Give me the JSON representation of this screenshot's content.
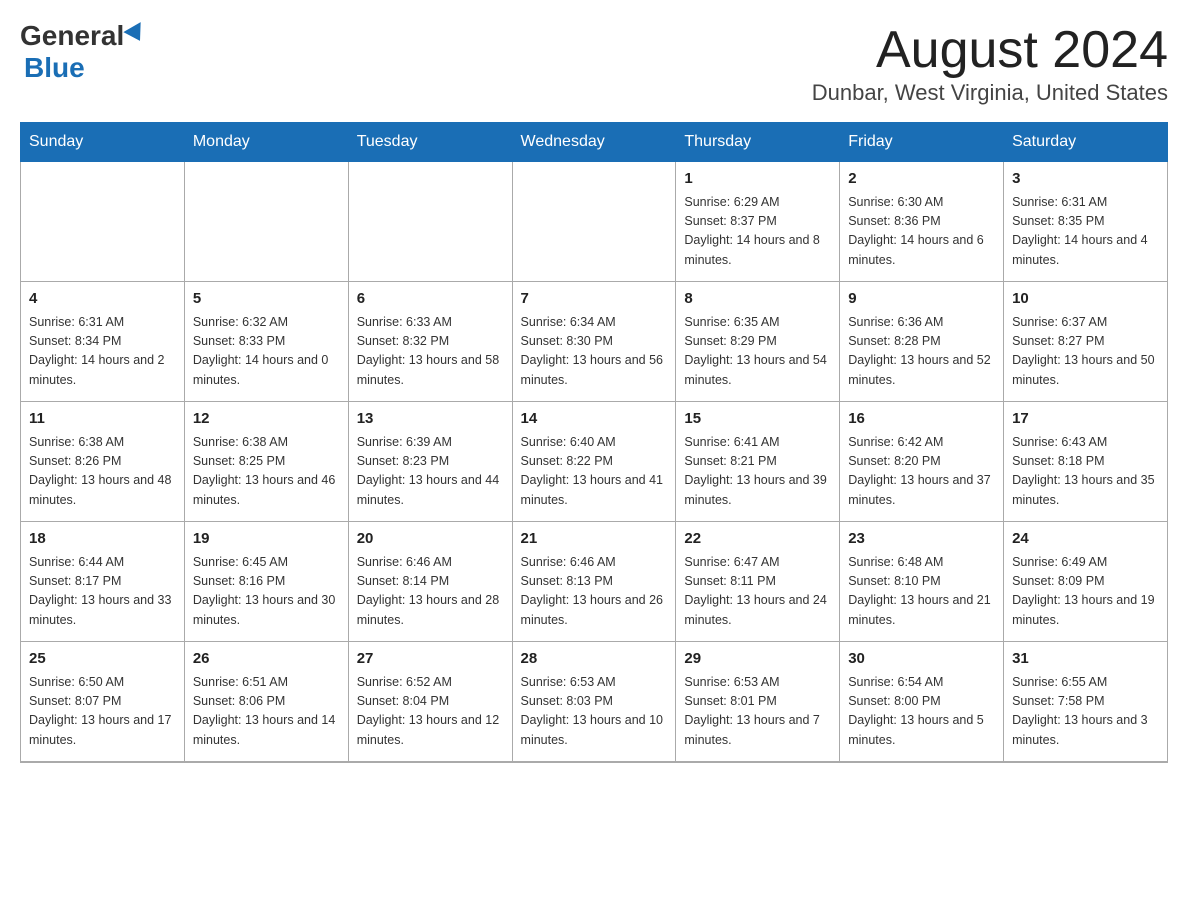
{
  "header": {
    "logo_general": "General",
    "logo_blue": "Blue",
    "title": "August 2024",
    "subtitle": "Dunbar, West Virginia, United States"
  },
  "days_of_week": [
    "Sunday",
    "Monday",
    "Tuesday",
    "Wednesday",
    "Thursday",
    "Friday",
    "Saturday"
  ],
  "weeks": [
    [
      {
        "day": "",
        "info": ""
      },
      {
        "day": "",
        "info": ""
      },
      {
        "day": "",
        "info": ""
      },
      {
        "day": "",
        "info": ""
      },
      {
        "day": "1",
        "info": "Sunrise: 6:29 AM\nSunset: 8:37 PM\nDaylight: 14 hours and 8 minutes."
      },
      {
        "day": "2",
        "info": "Sunrise: 6:30 AM\nSunset: 8:36 PM\nDaylight: 14 hours and 6 minutes."
      },
      {
        "day": "3",
        "info": "Sunrise: 6:31 AM\nSunset: 8:35 PM\nDaylight: 14 hours and 4 minutes."
      }
    ],
    [
      {
        "day": "4",
        "info": "Sunrise: 6:31 AM\nSunset: 8:34 PM\nDaylight: 14 hours and 2 minutes."
      },
      {
        "day": "5",
        "info": "Sunrise: 6:32 AM\nSunset: 8:33 PM\nDaylight: 14 hours and 0 minutes."
      },
      {
        "day": "6",
        "info": "Sunrise: 6:33 AM\nSunset: 8:32 PM\nDaylight: 13 hours and 58 minutes."
      },
      {
        "day": "7",
        "info": "Sunrise: 6:34 AM\nSunset: 8:30 PM\nDaylight: 13 hours and 56 minutes."
      },
      {
        "day": "8",
        "info": "Sunrise: 6:35 AM\nSunset: 8:29 PM\nDaylight: 13 hours and 54 minutes."
      },
      {
        "day": "9",
        "info": "Sunrise: 6:36 AM\nSunset: 8:28 PM\nDaylight: 13 hours and 52 minutes."
      },
      {
        "day": "10",
        "info": "Sunrise: 6:37 AM\nSunset: 8:27 PM\nDaylight: 13 hours and 50 minutes."
      }
    ],
    [
      {
        "day": "11",
        "info": "Sunrise: 6:38 AM\nSunset: 8:26 PM\nDaylight: 13 hours and 48 minutes."
      },
      {
        "day": "12",
        "info": "Sunrise: 6:38 AM\nSunset: 8:25 PM\nDaylight: 13 hours and 46 minutes."
      },
      {
        "day": "13",
        "info": "Sunrise: 6:39 AM\nSunset: 8:23 PM\nDaylight: 13 hours and 44 minutes."
      },
      {
        "day": "14",
        "info": "Sunrise: 6:40 AM\nSunset: 8:22 PM\nDaylight: 13 hours and 41 minutes."
      },
      {
        "day": "15",
        "info": "Sunrise: 6:41 AM\nSunset: 8:21 PM\nDaylight: 13 hours and 39 minutes."
      },
      {
        "day": "16",
        "info": "Sunrise: 6:42 AM\nSunset: 8:20 PM\nDaylight: 13 hours and 37 minutes."
      },
      {
        "day": "17",
        "info": "Sunrise: 6:43 AM\nSunset: 8:18 PM\nDaylight: 13 hours and 35 minutes."
      }
    ],
    [
      {
        "day": "18",
        "info": "Sunrise: 6:44 AM\nSunset: 8:17 PM\nDaylight: 13 hours and 33 minutes."
      },
      {
        "day": "19",
        "info": "Sunrise: 6:45 AM\nSunset: 8:16 PM\nDaylight: 13 hours and 30 minutes."
      },
      {
        "day": "20",
        "info": "Sunrise: 6:46 AM\nSunset: 8:14 PM\nDaylight: 13 hours and 28 minutes."
      },
      {
        "day": "21",
        "info": "Sunrise: 6:46 AM\nSunset: 8:13 PM\nDaylight: 13 hours and 26 minutes."
      },
      {
        "day": "22",
        "info": "Sunrise: 6:47 AM\nSunset: 8:11 PM\nDaylight: 13 hours and 24 minutes."
      },
      {
        "day": "23",
        "info": "Sunrise: 6:48 AM\nSunset: 8:10 PM\nDaylight: 13 hours and 21 minutes."
      },
      {
        "day": "24",
        "info": "Sunrise: 6:49 AM\nSunset: 8:09 PM\nDaylight: 13 hours and 19 minutes."
      }
    ],
    [
      {
        "day": "25",
        "info": "Sunrise: 6:50 AM\nSunset: 8:07 PM\nDaylight: 13 hours and 17 minutes."
      },
      {
        "day": "26",
        "info": "Sunrise: 6:51 AM\nSunset: 8:06 PM\nDaylight: 13 hours and 14 minutes."
      },
      {
        "day": "27",
        "info": "Sunrise: 6:52 AM\nSunset: 8:04 PM\nDaylight: 13 hours and 12 minutes."
      },
      {
        "day": "28",
        "info": "Sunrise: 6:53 AM\nSunset: 8:03 PM\nDaylight: 13 hours and 10 minutes."
      },
      {
        "day": "29",
        "info": "Sunrise: 6:53 AM\nSunset: 8:01 PM\nDaylight: 13 hours and 7 minutes."
      },
      {
        "day": "30",
        "info": "Sunrise: 6:54 AM\nSunset: 8:00 PM\nDaylight: 13 hours and 5 minutes."
      },
      {
        "day": "31",
        "info": "Sunrise: 6:55 AM\nSunset: 7:58 PM\nDaylight: 13 hours and 3 minutes."
      }
    ]
  ]
}
